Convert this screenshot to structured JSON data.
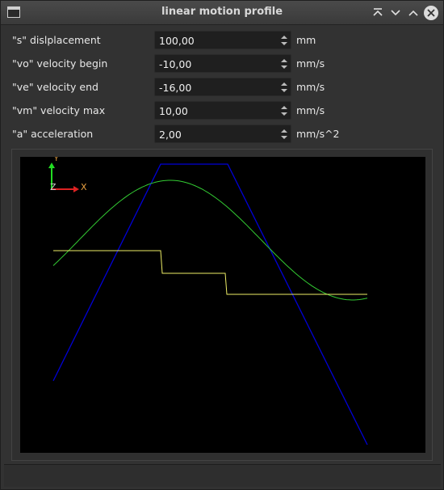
{
  "window": {
    "title": "linear motion profile"
  },
  "fields": [
    {
      "label": "\"s\" dislplacement",
      "value": "100,00",
      "unit": "mm"
    },
    {
      "label": "\"vo\" velocity begin",
      "value": "-10,00",
      "unit": "mm/s"
    },
    {
      "label": "\"ve\" velocity end",
      "value": "-16,00",
      "unit": "mm/s"
    },
    {
      "label": "\"vm\" velocity max",
      "value": "10,00",
      "unit": "mm/s"
    },
    {
      "label": "\"a\" acceleration",
      "value": "2,00",
      "unit": "mm/s^2"
    }
  ],
  "plot": {
    "axes": {
      "y_label": "Y",
      "x_label": "X",
      "z_label": "Z"
    },
    "colors": {
      "background": "#000000",
      "velocity": "#0000d8",
      "position": "#33cc33",
      "acceleration": "#eeee66",
      "y_axis": "#22dd22",
      "x_axis": "#dd2222"
    }
  }
}
